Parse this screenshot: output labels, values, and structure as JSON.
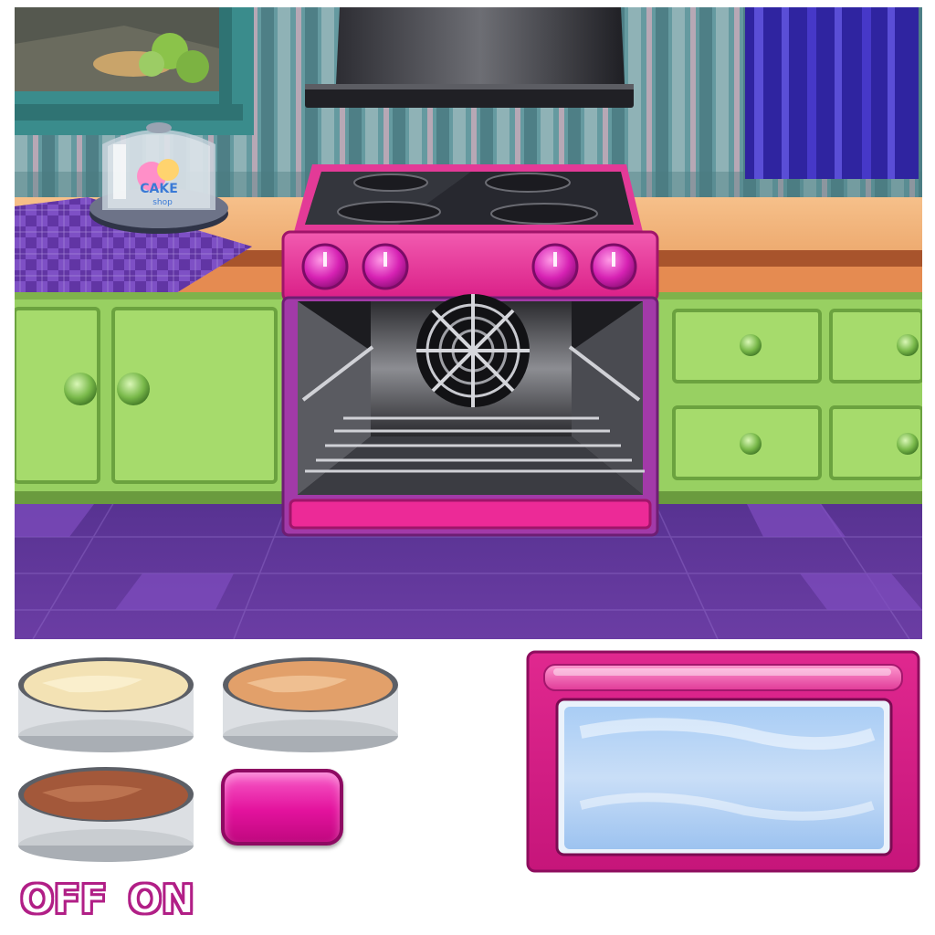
{
  "scene": {
    "cake_dome_logo_top": "CAKE",
    "cake_dome_logo_bottom": "shop"
  },
  "controls": {
    "off_label": "OFF",
    "on_label": "ON"
  },
  "pans": [
    {
      "name": "vanilla-batter-pan",
      "flavor": "vanilla",
      "color": "#f3e2b4"
    },
    {
      "name": "caramel-batter-pan",
      "flavor": "caramel",
      "color": "#e2a06a"
    },
    {
      "name": "chocolate-batter-pan",
      "flavor": "chocolate",
      "color": "#a3583a"
    }
  ],
  "colors": {
    "oven_pink": "#ec2a97",
    "oven_purple": "#a23aa8",
    "cabinet_green": "#a6db6c",
    "floor_purple": "#6a3a9e",
    "wall_teal": "#5d8f95",
    "curtain_blue": "#3a2db0"
  },
  "icons": [
    "oven-fan-icon",
    "oven-knob-icon",
    "cabinet-knob-icon"
  ]
}
